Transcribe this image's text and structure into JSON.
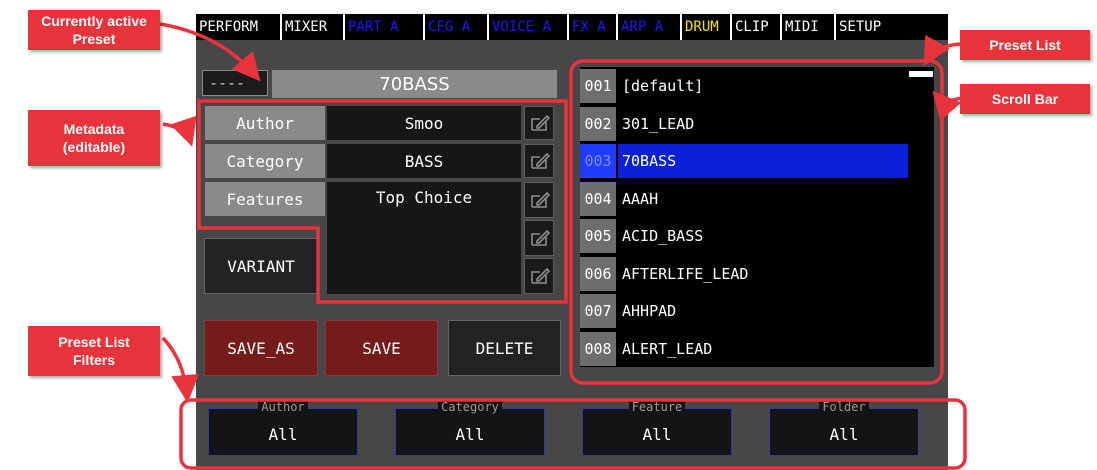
{
  "annotations": {
    "active_preset": "Currently active\nPreset",
    "metadata": "Metadata\n(editable)",
    "filters": "Preset List\nFilters",
    "preset_list": "Preset List",
    "scroll_bar": "Scroll Bar"
  },
  "tabs": [
    {
      "label": "PERFORM",
      "color": "#ffffff"
    },
    {
      "label": "MIXER",
      "color": "#ffffff"
    },
    {
      "label": "PART A",
      "color": "#1a1aff"
    },
    {
      "label": "CFG A",
      "color": "#1a1aff"
    },
    {
      "label": "VOICE A",
      "color": "#1a1aff"
    },
    {
      "label": "FX A",
      "color": "#1a1aff"
    },
    {
      "label": "ARP A",
      "color": "#1a1aff"
    },
    {
      "label": "DRUM",
      "color": "#ffe000"
    },
    {
      "label": "CLIP",
      "color": "#ffffff"
    },
    {
      "label": "MIDI",
      "color": "#ffffff"
    },
    {
      "label": "SETUP",
      "color": "#ffffff"
    }
  ],
  "preset": {
    "number": "----",
    "name": "70BASS"
  },
  "metadata": {
    "author_label": "Author",
    "author_value": "Smoo",
    "category_label": "Category",
    "category_value": "BASS",
    "features_label": "Features",
    "features_value": "Top Choice"
  },
  "buttons": {
    "variant": "VARIANT",
    "save_as": "SAVE_AS",
    "save": "SAVE",
    "delete": "DELETE"
  },
  "presets": [
    {
      "num": "001",
      "name": "[default]"
    },
    {
      "num": "002",
      "name": "301_LEAD"
    },
    {
      "num": "003",
      "name": "70BASS"
    },
    {
      "num": "004",
      "name": "AAAH"
    },
    {
      "num": "005",
      "name": "ACID_BASS"
    },
    {
      "num": "006",
      "name": "AFTERLIFE_LEAD"
    },
    {
      "num": "007",
      "name": "AHHPAD"
    },
    {
      "num": "008",
      "name": "ALERT_LEAD"
    }
  ],
  "selected_index": 2,
  "filters": [
    {
      "title": "Author",
      "value": "All"
    },
    {
      "title": "Category",
      "value": "All"
    },
    {
      "title": "Feature",
      "value": "All"
    },
    {
      "title": "Folder",
      "value": "All"
    }
  ],
  "colors": {
    "accent_red": "#e8323c",
    "selected_row": "#0a1fd6",
    "selected_num": "#1f3cff",
    "save_button": "#741c1c",
    "tab_inactive_blue": "#1a1aff",
    "tab_drum": "#ffe000"
  }
}
